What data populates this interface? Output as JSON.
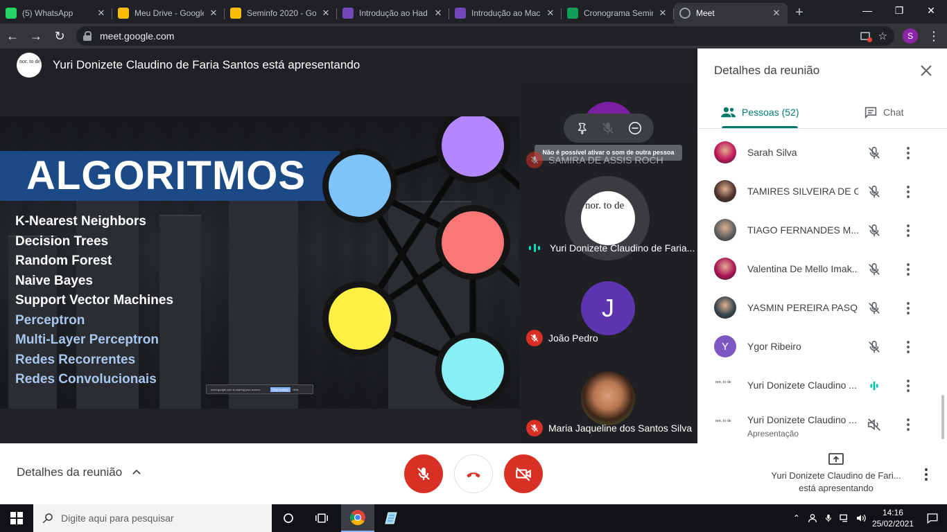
{
  "browser": {
    "tabs": [
      {
        "title": "(5) WhatsApp",
        "icon": "whatsapp-icon",
        "color": "#25d366"
      },
      {
        "title": "Meu Drive - Google",
        "icon": "drive-icon",
        "color": "#fbbc04"
      },
      {
        "title": "Seminfo 2020 - Go",
        "icon": "drive-icon",
        "color": "#fbbc04"
      },
      {
        "title": "Introdução ao Had",
        "icon": "forms-icon",
        "color": "#7248b9"
      },
      {
        "title": "Introdução ao Mac",
        "icon": "forms-icon",
        "color": "#7248b9"
      },
      {
        "title": "Cronograma Semin",
        "icon": "sheets-icon",
        "color": "#0f9d58"
      },
      {
        "title": "Meet",
        "icon": "globe-icon",
        "color": "#9aa0a6",
        "active": true
      }
    ],
    "url": "meet.google.com",
    "profile_initial": "S"
  },
  "meeting": {
    "presenter_banner": "Yuri Donizete Claudino de Faria Santos está apresentando",
    "presenter_avatar_text": "nor. to de",
    "slide": {
      "title": "ALGORITMOS",
      "items": [
        {
          "text": "K-Nearest Neighbors",
          "highlight": false
        },
        {
          "text": "Decision Trees",
          "highlight": false
        },
        {
          "text": "Random Forest",
          "highlight": false
        },
        {
          "text": "Naive Bayes",
          "highlight": false
        },
        {
          "text": "Support Vector Machines",
          "highlight": false
        },
        {
          "text": "Perceptron",
          "highlight": true
        },
        {
          "text": "Multi-Layer Perceptron",
          "highlight": true
        },
        {
          "text": "Redes Recorrentes",
          "highlight": true
        },
        {
          "text": "Redes Convolucionais",
          "highlight": true
        }
      ],
      "share_bar_text": "meet.google.com is sharing your screen.",
      "share_bar_stop": "Stop sharing",
      "share_bar_hide": "Hide"
    },
    "tiles": [
      {
        "name": "SAMIRA DE ASSIS ROCH",
        "muted": true,
        "avatar_color": "#7b1fa2"
      },
      {
        "name": "Yuri Donizete Claudino de Faria...",
        "muted": false,
        "speaking": true,
        "avatar_text": "nor. to de"
      },
      {
        "name": "João Pedro",
        "muted": true,
        "initial": "J",
        "avatar_color": "#5e35b1"
      },
      {
        "name": "Maria Jaqueline dos Santos Silva",
        "muted": true
      }
    ],
    "tooltip": "Não é possível ativar o som de outra pessoa"
  },
  "panel": {
    "title": "Detalhes da reunião",
    "tab_people": "Pessoas (52)",
    "tab_chat": "Chat",
    "people": [
      {
        "name": "Sarah Silva",
        "avatar": "photo",
        "color": "#c2185b",
        "mic": "muted"
      },
      {
        "name": "TAMIRES SILVEIRA DE O...",
        "avatar": "photo",
        "color": "#4e342e",
        "mic": "muted"
      },
      {
        "name": "TIAGO FERNANDES M...",
        "avatar": "photo",
        "color": "#616161",
        "mic": "muted"
      },
      {
        "name": "Valentina De Mello Imak...",
        "avatar": "photo",
        "color": "#ad1457",
        "mic": "muted"
      },
      {
        "name": "YASMIN PEREIRA PASQ...",
        "avatar": "photo",
        "color": "#37474f",
        "mic": "muted"
      },
      {
        "name": "Ygor Ribeiro",
        "avatar": "initial",
        "initial": "Y",
        "color": "#7e57c2",
        "mic": "muted"
      },
      {
        "name": "Yuri Donizete Claudino ...",
        "avatar": "text",
        "avatar_text": "nor. to de",
        "color": "#ffffff",
        "mic": "speaking"
      },
      {
        "name": "Yuri Donizete Claudino ...",
        "sub": "Apresentação",
        "avatar": "text",
        "avatar_text": "nor. to de",
        "color": "#ffffff",
        "mic": "audio-off"
      }
    ]
  },
  "bottom": {
    "details_label": "Detalhes da reunião",
    "presenting_name": "Yuri Donizete Claudino de Fari...",
    "presenting_status": "está apresentando"
  },
  "taskbar": {
    "search_placeholder": "Digite aqui para pesquisar",
    "time": "14:16",
    "date": "25/02/2021"
  }
}
